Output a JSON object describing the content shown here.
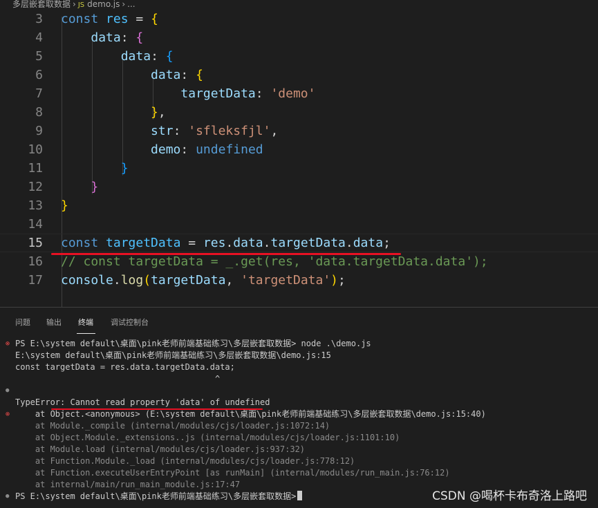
{
  "breadcrumb": {
    "folder": "多层嵌套取数据",
    "file": "demo.js",
    "symbol": "..."
  },
  "editor": {
    "active_line": 15,
    "line_numbers": [
      3,
      4,
      5,
      6,
      7,
      8,
      9,
      10,
      11,
      12,
      13,
      14,
      15,
      16,
      17
    ]
  },
  "panel": {
    "tabs": [
      {
        "label": "问题",
        "active": false
      },
      {
        "label": "输出",
        "active": false
      },
      {
        "label": "终端",
        "active": true
      },
      {
        "label": "调试控制台",
        "active": false
      }
    ]
  },
  "terminal": {
    "lines": [
      {
        "text": "PS E:\\system default\\桌面\\pink老师前端基础练习\\多层嵌套取数据> node .\\demo.js",
        "marker": "err",
        "dim": false
      },
      {
        "text": "E:\\system default\\桌面\\pink老师前端基础练习\\多层嵌套取数据\\demo.js:15",
        "marker": "",
        "dim": false
      },
      {
        "text": "const targetData = res.data.targetData.data;",
        "marker": "",
        "dim": false
      },
      {
        "text": "                                        ^",
        "marker": "",
        "dim": false
      },
      {
        "text": "",
        "marker": "info",
        "dim": false
      },
      {
        "text": "TypeError: Cannot read property 'data' of undefined",
        "marker": "",
        "dim": false
      },
      {
        "text": "    at Object.<anonymous> (E:\\system default\\桌面\\pink老师前端基础练习\\多层嵌套取数据\\demo.js:15:40)",
        "marker": "err",
        "dim": false
      },
      {
        "text": "    at Module._compile (internal/modules/cjs/loader.js:1072:14)",
        "marker": "",
        "dim": true
      },
      {
        "text": "    at Object.Module._extensions..js (internal/modules/cjs/loader.js:1101:10)",
        "marker": "",
        "dim": true
      },
      {
        "text": "    at Module.load (internal/modules/cjs/loader.js:937:32)",
        "marker": "",
        "dim": true
      },
      {
        "text": "    at Function.Module._load (internal/modules/cjs/loader.js:778:12)",
        "marker": "",
        "dim": true
      },
      {
        "text": "    at Function.executeUserEntryPoint [as runMain] (internal/modules/run_main.js:76:12)",
        "marker": "",
        "dim": true
      },
      {
        "text": "    at internal/main/run_main_module.js:17:47",
        "marker": "",
        "dim": true
      },
      {
        "text": "PS E:\\system default\\桌面\\pink老师前端基础练习\\多层嵌套取数据>",
        "marker": "info",
        "dim": false
      }
    ]
  },
  "watermark": "CSDN @喝杯卡布奇洛上路吧",
  "colors": {
    "keyword": "#569cd6",
    "variable": "#4fc1ff",
    "property": "#9cdcfe",
    "string": "#ce9178",
    "comment": "#6a9955",
    "error": "#e81123"
  }
}
